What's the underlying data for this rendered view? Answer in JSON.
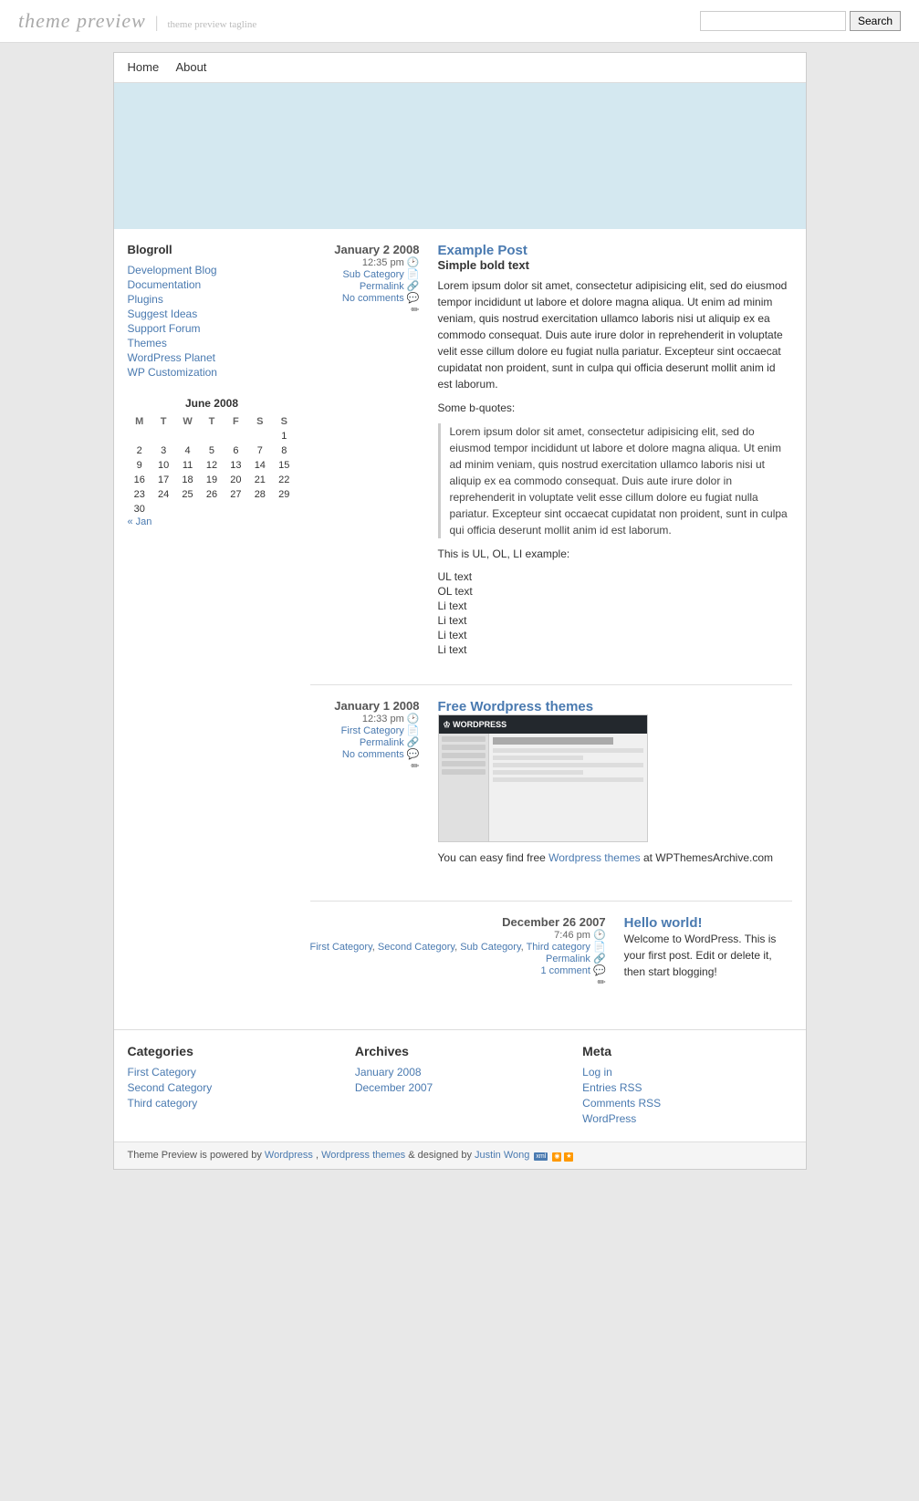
{
  "header": {
    "site_title": "theme preview",
    "divider": "|",
    "tagline": "theme preview tagline",
    "search_placeholder": "",
    "search_button": "Search"
  },
  "nav": {
    "items": [
      {
        "label": "Home",
        "href": "#"
      },
      {
        "label": "About",
        "href": "#"
      }
    ]
  },
  "sidebar": {
    "blogroll_title": "Blogroll",
    "blogroll_links": [
      {
        "label": "Development Blog"
      },
      {
        "label": "Documentation"
      },
      {
        "label": "Plugins"
      },
      {
        "label": "Suggest Ideas"
      },
      {
        "label": "Support Forum"
      },
      {
        "label": "Themes"
      },
      {
        "label": "WordPress Planet"
      },
      {
        "label": "WP Customization"
      }
    ],
    "calendar": {
      "title": "June 2008",
      "days_header": [
        "M",
        "T",
        "W",
        "T",
        "F",
        "S",
        "S"
      ],
      "weeks": [
        [
          "",
          "",
          "",
          "",
          "",
          "",
          "1"
        ],
        [
          "2",
          "3",
          "4",
          "5",
          "6",
          "7",
          "8"
        ],
        [
          "9",
          "10",
          "11",
          "12",
          "13",
          "14",
          "15"
        ],
        [
          "16",
          "17",
          "18",
          "19",
          "20",
          "21",
          "22"
        ],
        [
          "23",
          "24",
          "25",
          "26",
          "27",
          "28",
          "29"
        ],
        [
          "30",
          "",
          "",
          "",
          "",
          "",
          ""
        ]
      ],
      "prev": "« Jan"
    }
  },
  "posts": [
    {
      "date": "January 2 2008",
      "time": "12:35 pm",
      "category": "Sub Category",
      "permalink": "Permalink",
      "comments": "No comments",
      "title": "Example Post",
      "title_href": "#",
      "subtitle": "Simple bold text",
      "paragraphs": [
        "Lorem ipsum dolor sit amet, consectetur adipisicing elit, sed do eiusmod tempor incididunt ut labore et dolore magna aliqua. Ut enim ad minim veniam, quis nostrud exercitation ullamco laboris nisi ut aliquip ex ea commodo consequat. Duis aute irure dolor in reprehenderit in voluptate velit esse cillum dolore eu fugiat nulla pariatur. Excepteur sint occaecat cupidatat non proident, sunt in culpa qui officia deserunt mollit anim id est laborum."
      ],
      "blockquote_label": "Some b-quotes:",
      "blockquote": "Lorem ipsum dolor sit amet, consectetur adipisicing elit, sed do eiusmod tempor incididunt ut labore et dolore magna aliqua. Ut enim ad minim veniam, quis nostrud exercitation ullamco laboris nisi ut aliquip ex ea commodo consequat. Duis aute irure dolor in reprehenderit in voluptate velit esse cillum dolore eu fugiat nulla pariatur. Excepteur sint occaecat cupidatat non proident, sunt in culpa qui officia deserunt mollit anim id est laborum.",
      "list_label": "This is UL, OL, LI example:",
      "list_items": [
        "UL text",
        "OL text",
        "Li text",
        "Li text",
        "Li text",
        "Li text"
      ]
    },
    {
      "date": "January 1 2008",
      "time": "12:33 pm",
      "category": "First Category",
      "permalink": "Permalink",
      "comments": "No comments",
      "title": "Free Wordpress themes",
      "title_href": "#",
      "has_image": true,
      "text_after_image": "You can easy find free",
      "wordpress_themes_link": "Wordpress themes",
      "text_after_link": "at WPThemesArchive.com"
    },
    {
      "date": "December 26 2007",
      "time": "7:46 pm",
      "categories": "First Category, Second Category, Sub Category, Third category",
      "permalink": "Permalink",
      "comments": "1 comment",
      "title": "Hello world!",
      "title_href": "#",
      "paragraphs": [
        "Welcome to WordPress. This is your first post. Edit or delete it, then start blogging!"
      ]
    }
  ],
  "footer_widgets": {
    "categories": {
      "title": "Categories",
      "items": [
        {
          "label": "First Category"
        },
        {
          "label": "Second Category"
        },
        {
          "label": "Third category"
        }
      ]
    },
    "archives": {
      "title": "Archives",
      "items": [
        {
          "label": "January 2008"
        },
        {
          "label": "December 2007"
        }
      ]
    },
    "meta": {
      "title": "Meta",
      "items": [
        {
          "label": "Log in"
        },
        {
          "label": "Entries RSS"
        },
        {
          "label": "Comments RSS"
        },
        {
          "label": "WordPress"
        }
      ]
    }
  },
  "footer": {
    "text": "Theme Preview is powered by",
    "wordpress_link": "Wordpress",
    "comma": ",",
    "themes_link": "Wordpress themes",
    "middle": "& designed by",
    "designer_link": "Justin Wong"
  }
}
